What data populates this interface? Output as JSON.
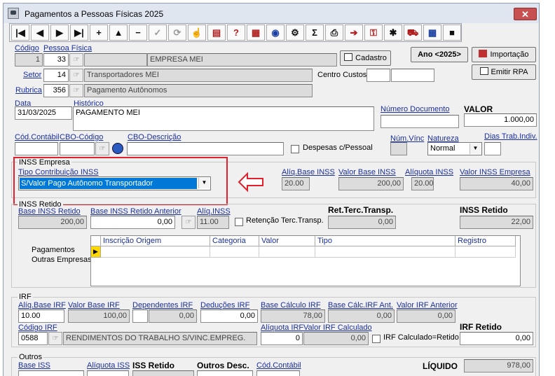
{
  "window": {
    "title": "Pagamentos a Pessoas Físicas 2025",
    "close_label": "✕"
  },
  "toolbar": [
    {
      "name": "first-record-button",
      "glyph": "|◀",
      "cls": ""
    },
    {
      "name": "prev-record-button",
      "glyph": "◀",
      "cls": ""
    },
    {
      "name": "next-record-button",
      "glyph": "▶",
      "cls": ""
    },
    {
      "name": "last-record-button",
      "glyph": "▶|",
      "cls": ""
    },
    {
      "name": "add-record-button",
      "glyph": "+",
      "cls": ""
    },
    {
      "name": "edit-record-button",
      "glyph": "▲",
      "cls": ""
    },
    {
      "name": "delete-record-button",
      "glyph": "−",
      "cls": ""
    },
    {
      "name": "confirm-button",
      "glyph": "✓",
      "cls": "dis"
    },
    {
      "name": "refresh-button",
      "glyph": "⟳",
      "cls": "dis"
    },
    {
      "name": "hand-button",
      "glyph": "☝",
      "cls": "col"
    },
    {
      "name": "filter-button",
      "glyph": "▤",
      "cls": "col"
    },
    {
      "name": "query-button",
      "glyph": "?",
      "cls": "col"
    },
    {
      "name": "grid-tool-button",
      "glyph": "▦",
      "cls": "col"
    },
    {
      "name": "globe-button",
      "glyph": "◉",
      "cls": "blu"
    },
    {
      "name": "tools-button",
      "glyph": "⚙",
      "cls": ""
    },
    {
      "name": "sum-button",
      "glyph": "Σ",
      "cls": ""
    },
    {
      "name": "print-button",
      "glyph": "⎙",
      "cls": ""
    },
    {
      "name": "export-button",
      "glyph": "➔",
      "cls": "col"
    },
    {
      "name": "key-button",
      "glyph": "⚿",
      "cls": "col"
    },
    {
      "name": "settings-button",
      "glyph": "✱",
      "cls": ""
    },
    {
      "name": "car-button",
      "glyph": "⛟",
      "cls": "col"
    },
    {
      "name": "calendar-button",
      "glyph": "▦",
      "cls": "blu"
    },
    {
      "name": "stop-button",
      "glyph": "■",
      "cls": ""
    }
  ],
  "header": {
    "codigo_label": "Código",
    "codigo_value": "1",
    "pessoa_label": "Pessoa Física",
    "pessoa_code": "33",
    "pessoa_name": "EMPRESA MEI",
    "cadastro_label": "Cadastro",
    "setor_label": "Setor",
    "setor_code": "14",
    "setor_name": "Transportadores MEI",
    "rubrica_label": "Rubrica",
    "rubrica_code": "356",
    "rubrica_name": "Pagamento Autônomos",
    "ano_label": "Ano <2025>",
    "importacao_label": "Importação",
    "emitir_label": "Emitir RPA",
    "centro_custos_label": "Centro Custos"
  },
  "details": {
    "data_label": "Data",
    "data_value": "31/03/2025",
    "historico_label": "Histórico",
    "historico_value": "PAGAMENTO MEI",
    "numero_doc_label": "Número Documento",
    "valor_label": "VALOR",
    "valor_value": "1.000,00",
    "cod_contabil_label": "Cód.Contábil",
    "cbo_codigo_label": "CBO-Código",
    "cbo_descricao_label": "CBO-Descrição",
    "despesas_label": "Despesas c/Pessoal",
    "num_vinc_label": "Núm.Vínc",
    "natureza_label": "Natureza",
    "natureza_value": "Normal",
    "dias_trab_label": "Dias Trab.Indiv."
  },
  "inss_empresa": {
    "title": "INSS Empresa",
    "tipo_label": "Tipo Contribuição INSS",
    "tipo_value": "S/Valor Pago Autônomo Transportador",
    "aliq_base_label": "Alíq.Base INSS",
    "aliq_base_value": "20.00",
    "valor_base_label": "Valor Base INSS",
    "valor_base_value": "200,00",
    "aliquota_label": "Alíquota INSS",
    "aliquota_value": "20.00",
    "valor_empresa_label": "Valor INSS Empresa",
    "valor_empresa_value": "40,00"
  },
  "inss_retido": {
    "title": "INSS Retido",
    "base_label": "Base INSS Retido",
    "base_value": "200,00",
    "base_ant_label": "Base INSS Retido Anterior",
    "base_ant_value": "0,00",
    "aliq_label": "Alíq.INSS",
    "aliq_value": "11.00",
    "retencao_label": "Retenção Terc.Transp.",
    "ret_terc_label": "Ret.Terc.Transp.",
    "ret_terc_value": "0,00",
    "inss_retido_label": "INSS Retido",
    "inss_retido_value": "22,00",
    "pagamentos_label1": "Pagamentos",
    "pagamentos_label2": "Outras Empresas",
    "columns": [
      "Inscrição Origem",
      "Categoria",
      "Valor",
      "Tipo",
      "Registro"
    ]
  },
  "irf": {
    "title": "IRF",
    "aliq_base_label": "Alíq.Base IRF",
    "aliq_base_value": "10.00",
    "valor_base_label": "Valor Base IRF",
    "valor_base_value": "100,00",
    "dependentes_label": "Dependentes IRF",
    "dependentes_value": "0,00",
    "deducoes_label": "Deduções IRF",
    "deducoes_value": "0,00",
    "base_calc_label": "Base Cálculo IRF",
    "base_calc_value": "78,00",
    "base_calc_ant_label": "Base Cálc.IRF Ant.",
    "base_calc_ant_value": "0,00",
    "valor_ant_label": "Valor IRF Anterior",
    "valor_ant_value": "0,00",
    "codigo_label": "Código IRF",
    "codigo_value": "0588",
    "codigo_desc": "RENDIMENTOS DO TRABALHO S/VINC.EMPREG.",
    "aliquota_label": "Alíquota IRF",
    "aliquota_value": "0",
    "valor_calc_label": "Valor IRF Calculado",
    "valor_calc_value": "0,00",
    "calc_retido_label": "IRF Calculado=Retido",
    "irf_retido_label": "IRF Retido",
    "irf_retido_value": "0,00"
  },
  "outros": {
    "title": "Outros",
    "base_iss_label": "Base ISS",
    "aliquota_iss_label": "Alíquota ISS",
    "iss_retido_label": "ISS Retido",
    "outros_desc_label": "Outros Desc.",
    "cod_contabil_label": "Cód.Contábil",
    "liquido_label": "LÍQUIDO",
    "liquido_value": "978,00"
  }
}
